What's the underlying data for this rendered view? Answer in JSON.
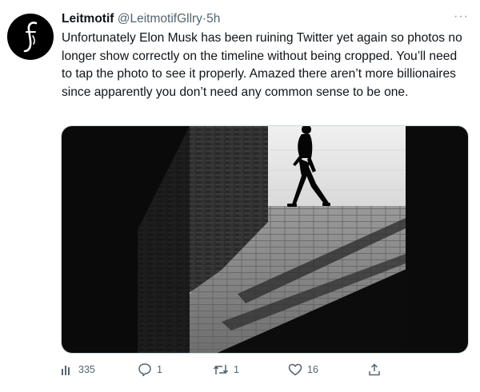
{
  "tweet": {
    "display_name": "Leitmotif",
    "handle": "@LeitmotifGllry",
    "separator": "·",
    "time": "5h",
    "more_label": "···",
    "avatar_icon": "leitmotif-logo-f",
    "text": "Unfortunately Elon Musk has been ruining Twitter yet again so photos no longer show correctly on the timeline without being cropped. You’ll need to tap the photo to see it properly. Amazed there aren’t more billionaires since apparently you don’t need any common sense to be one.",
    "media": {
      "subject": "black-and-white photo of a person walking past a sunlit gap between brick walls",
      "colors": {
        "shadow": "#0a0a0a",
        "brick": "#3a3a3a",
        "pavement": "#8d8d8d",
        "water": "#e9e9e9"
      }
    },
    "actions": {
      "views": "335",
      "replies": "1",
      "retweets": "1",
      "likes": "16"
    },
    "colors": {
      "text": "#0f1419",
      "muted": "#536471",
      "border": "#cfd9de"
    }
  }
}
